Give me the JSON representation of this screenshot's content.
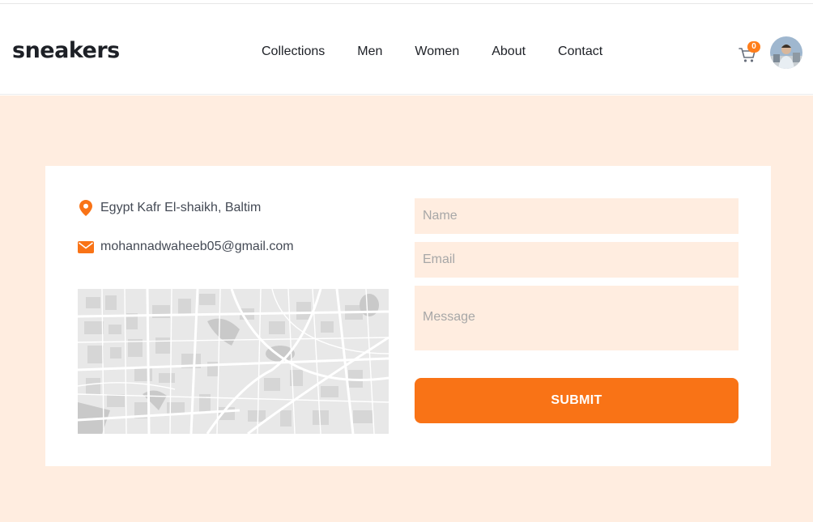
{
  "brand": {
    "logo": "sneakers"
  },
  "nav": {
    "items": [
      {
        "label": "Collections"
      },
      {
        "label": "Men"
      },
      {
        "label": "Women"
      },
      {
        "label": "About"
      },
      {
        "label": "Contact"
      }
    ]
  },
  "cart": {
    "count": "0",
    "icon": "cart-icon"
  },
  "user": {
    "avatar": "avatar"
  },
  "contact": {
    "location": {
      "icon": "location-pin-icon",
      "text": "Egypt Kafr El-shaikh, Baltim"
    },
    "email": {
      "icon": "mail-icon",
      "text": "mohannadwaheeb05@gmail.com"
    }
  },
  "form": {
    "name_placeholder": "Name",
    "email_placeholder": "Email",
    "message_placeholder": "Message",
    "submit_label": "SUBMIT"
  },
  "colors": {
    "accent": "#f97316",
    "background_tint": "#ffede0",
    "text_dark": "#1d2026"
  }
}
